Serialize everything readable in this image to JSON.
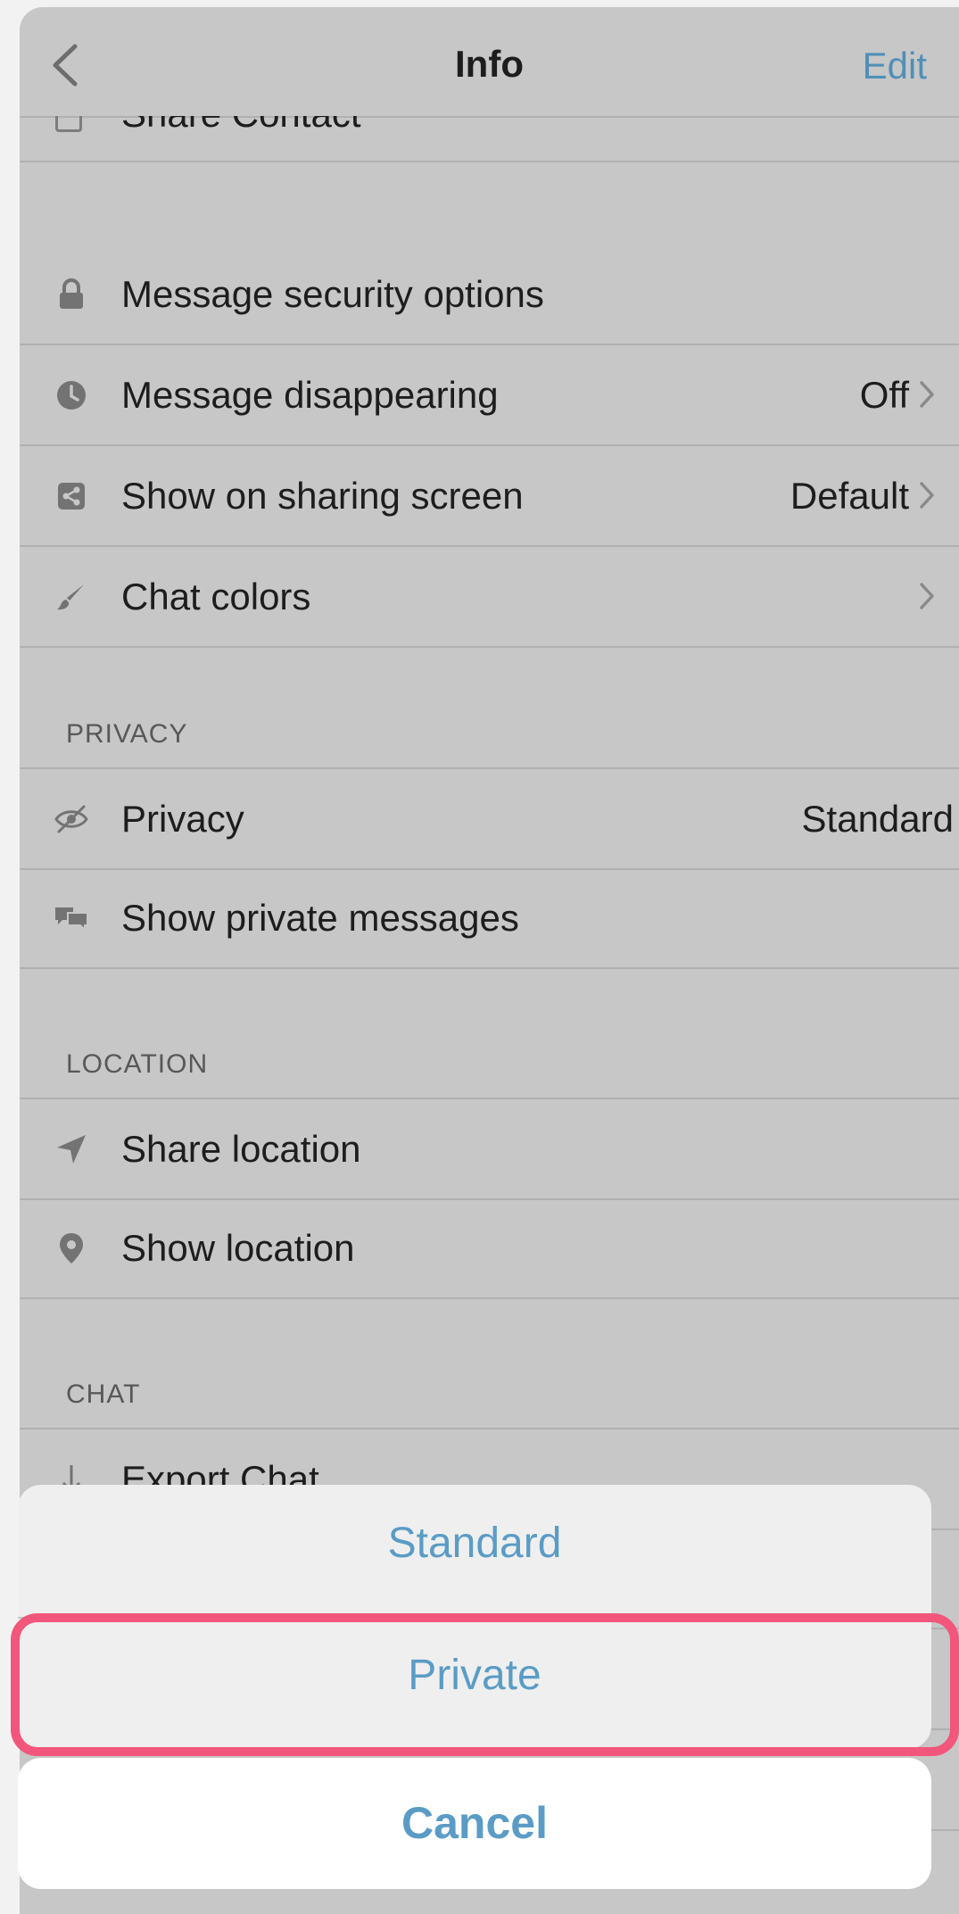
{
  "nav": {
    "back_icon": "chevron-left-icon",
    "title": "Info",
    "edit": "Edit"
  },
  "clipped_row": {
    "label": "Share Contact",
    "icon": "contact-card-icon"
  },
  "settings": [
    {
      "label": "Message security options",
      "value": "",
      "icon": "lock-icon"
    },
    {
      "label": "Message disappearing",
      "value": "Off",
      "icon": "clock-icon"
    },
    {
      "label": "Show on sharing screen",
      "value": "Default",
      "icon": "share-icon"
    },
    {
      "label": "Chat colors",
      "value": "",
      "icon": "brush-icon"
    }
  ],
  "privacy": {
    "header": "PRIVACY",
    "items": [
      {
        "label": "Privacy",
        "value": "Standard",
        "icon": "eye-slash-icon"
      },
      {
        "label": "Show private messages",
        "value": "",
        "icon": "chat-bubbles-icon"
      }
    ]
  },
  "location": {
    "header": "LOCATION",
    "items": [
      {
        "label": "Share location",
        "icon": "location-arrow-icon"
      },
      {
        "label": "Show location",
        "icon": "map-pin-icon"
      }
    ]
  },
  "chat": {
    "header": "CHAT",
    "items": [
      {
        "label": "Export Chat",
        "icon": "download-arrow-icon"
      }
    ]
  },
  "action_sheet": {
    "options": [
      "Standard",
      "Private"
    ],
    "cancel": "Cancel",
    "highlighted_option": "Private"
  },
  "colors": {
    "accent": "#5a9cc6",
    "highlight": "#f2567a",
    "dimmed_bg": "#c7c7c7"
  }
}
